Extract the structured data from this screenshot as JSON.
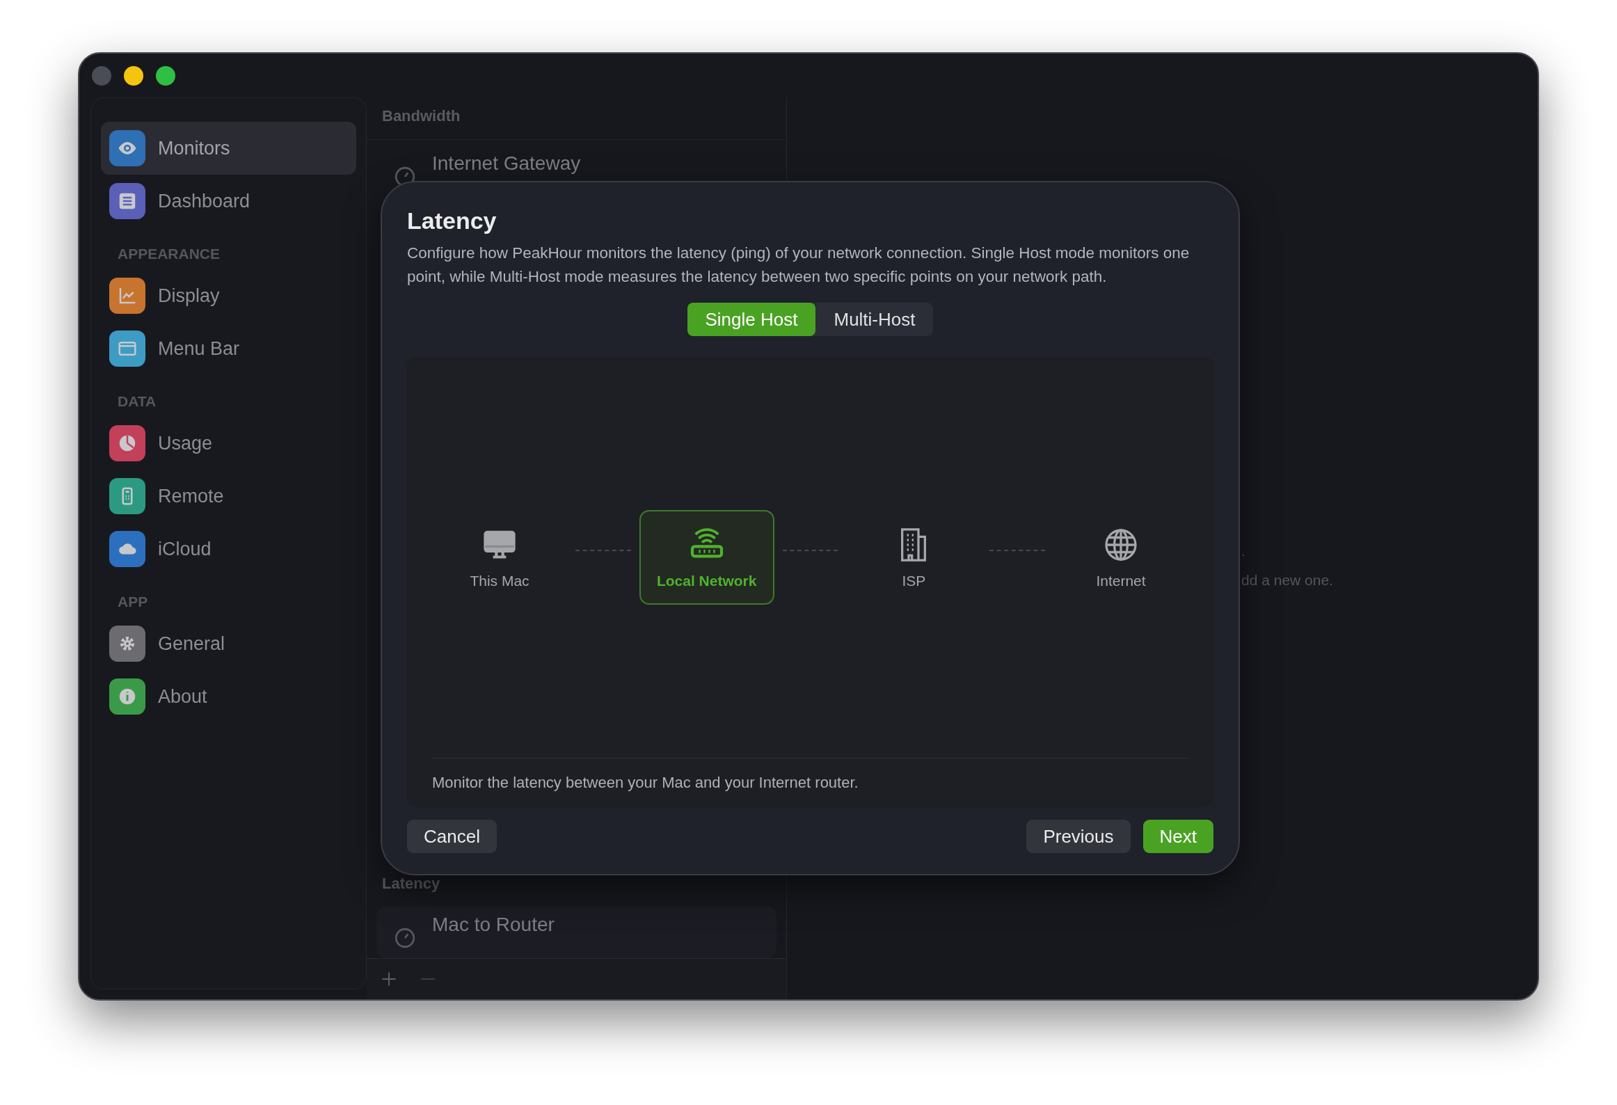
{
  "sidebar": {
    "sections": [
      {
        "items": [
          {
            "label": "Monitors",
            "kind": "eye",
            "color": "#2f6fb3",
            "selected": true
          },
          {
            "label": "Dashboard",
            "kind": "list",
            "color": "#5a5fb8",
            "selected": false
          }
        ]
      },
      {
        "heading": "APPEARANCE",
        "items": [
          {
            "label": "Display",
            "kind": "chart",
            "color": "#c7742f",
            "selected": false
          },
          {
            "label": "Menu Bar",
            "kind": "window",
            "color": "#3d9cc4",
            "selected": false
          }
        ]
      },
      {
        "heading": "DATA",
        "items": [
          {
            "label": "Usage",
            "kind": "pie",
            "color": "#c2405a",
            "selected": false
          },
          {
            "label": "Remote",
            "kind": "phone",
            "color": "#2c9a82",
            "selected": false
          },
          {
            "label": "iCloud",
            "kind": "cloud",
            "color": "#2d6fbf",
            "selected": false
          }
        ]
      },
      {
        "heading": "APP",
        "items": [
          {
            "label": "General",
            "kind": "gear",
            "color": "#6b6b70",
            "selected": false
          },
          {
            "label": "About",
            "kind": "info",
            "color": "#3b9a48",
            "selected": false
          }
        ]
      }
    ]
  },
  "monitor_list": {
    "groups": [
      {
        "heading": "Bandwidth",
        "items": [
          {
            "label": "Internet Gateway"
          }
        ]
      },
      {
        "heading": "Latency",
        "items": [
          {
            "label": "Mac to Router"
          }
        ]
      }
    ]
  },
  "detail": {
    "lines": [
      ".",
      "dd a new one."
    ]
  },
  "dialog": {
    "title": "Latency",
    "description": "Configure how PeakHour monitors the latency (ping) of your network connection. Single Host mode monitors one point, while Multi-Host mode measures the latency between two specific points on your network path.",
    "mode_tabs": [
      {
        "label": "Single Host",
        "selected": true
      },
      {
        "label": "Multi-Host",
        "selected": false
      }
    ],
    "path_nodes": [
      {
        "label": "This Mac",
        "kind": "computer",
        "selected": false
      },
      {
        "label": "Local Network",
        "kind": "router",
        "selected": true
      },
      {
        "label": "ISP",
        "kind": "building",
        "selected": false
      },
      {
        "label": "Internet",
        "kind": "globe",
        "selected": false
      }
    ],
    "footer_text": "Monitor the latency between your Mac and your Internet router.",
    "buttons": [
      {
        "label": "Cancel",
        "kind": "secondary"
      },
      {
        "label": "Previous",
        "kind": "secondary"
      },
      {
        "label": "Next",
        "kind": "primary"
      }
    ]
  }
}
